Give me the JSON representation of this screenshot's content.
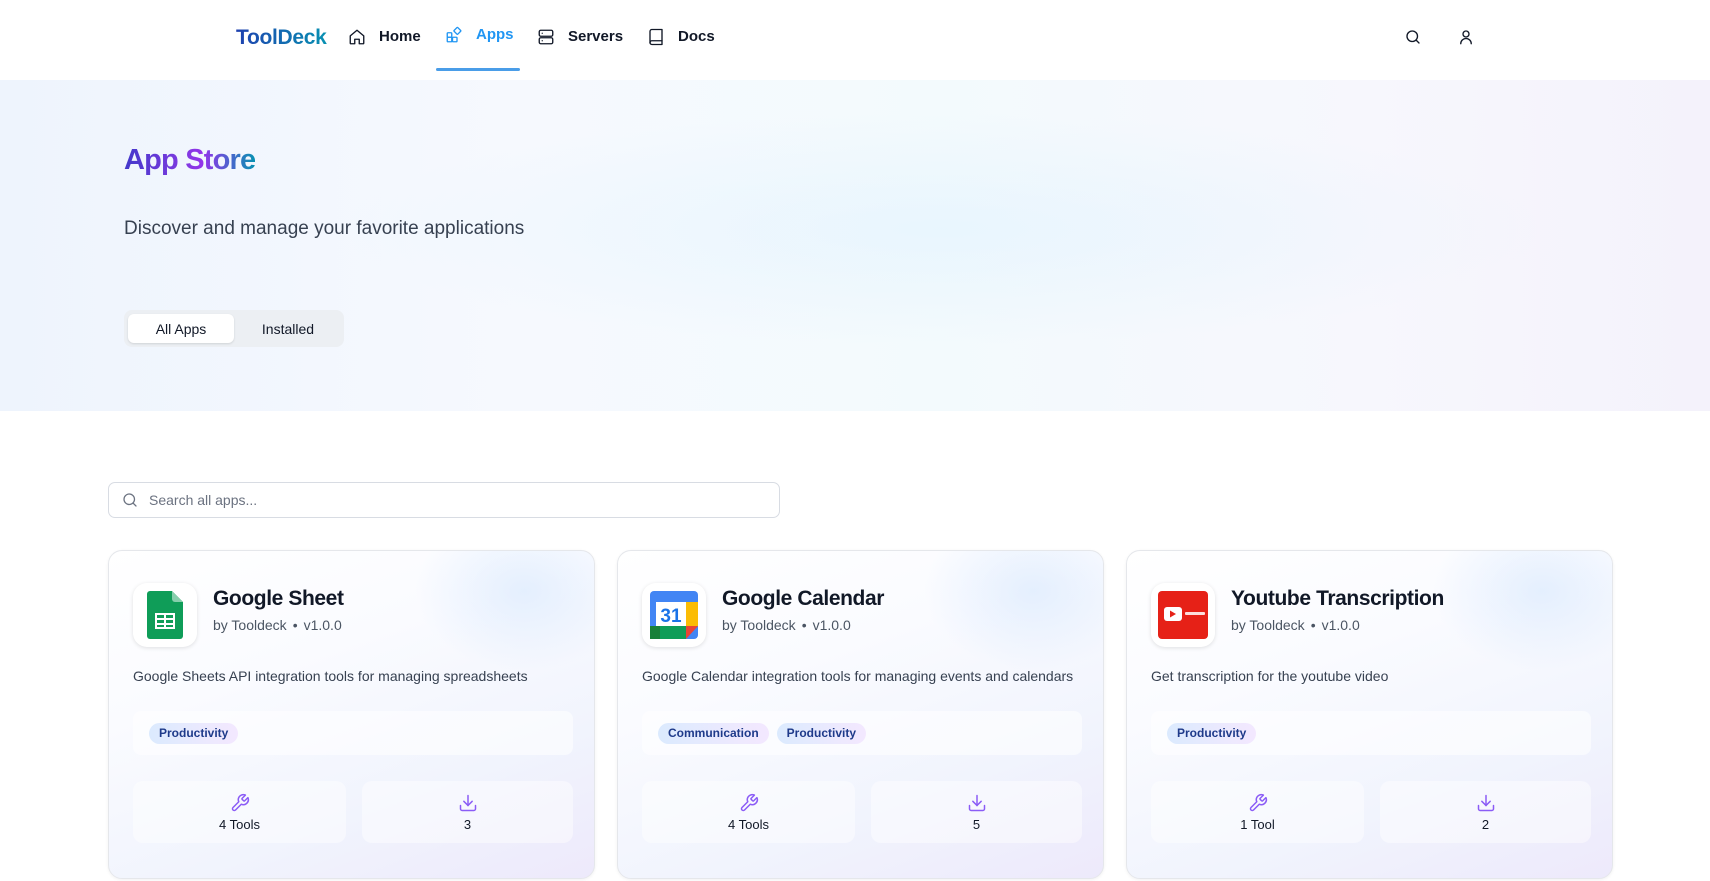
{
  "nav": {
    "brand": "ToolDeck",
    "items": [
      {
        "label": "Home",
        "icon": "home-icon"
      },
      {
        "label": "Apps",
        "icon": "apps-icon",
        "active": true
      },
      {
        "label": "Servers",
        "icon": "server-icon"
      },
      {
        "label": "Docs",
        "icon": "book-icon"
      }
    ],
    "right_icons": [
      "search-icon",
      "user-icon"
    ],
    "active_color": "#2196f3"
  },
  "hero": {
    "title": "App Store",
    "subtitle": "Discover and manage your favorite applications",
    "tabs": [
      {
        "label": "All Apps",
        "selected": true
      },
      {
        "label": "Installed",
        "selected": false
      }
    ]
  },
  "search": {
    "placeholder": "Search all apps...",
    "value": ""
  },
  "cards": [
    {
      "title": "Google Sheet",
      "author": "by Tooldeck",
      "separator": "•",
      "version": "v1.0.0",
      "description": "Google Sheets API integration tools for managing spreadsheets",
      "tags": [
        "Productivity"
      ],
      "tools": "4 Tools",
      "installs": "3",
      "icon": "google-sheets-icon"
    },
    {
      "title": "Google Calendar",
      "author": "by Tooldeck",
      "separator": "•",
      "version": "v1.0.0",
      "description": "Google Calendar integration tools for managing events and calendars",
      "tags": [
        "Communication",
        "Productivity"
      ],
      "tools": "4 Tools",
      "installs": "5",
      "icon": "google-calendar-icon",
      "icon_text": "31"
    },
    {
      "title": "Youtube Transcription",
      "author": "by Tooldeck",
      "separator": "•",
      "version": "v1.0.0",
      "description": "Get transcription for the youtube video",
      "tags": [
        "Productivity"
      ],
      "tools": "1 Tool",
      "installs": "2",
      "icon": "youtube-icon"
    }
  ],
  "colors": {
    "accent": "#2196f3",
    "stat_icon": "#8b5cf6",
    "tag_text": "#1e3a8a"
  }
}
